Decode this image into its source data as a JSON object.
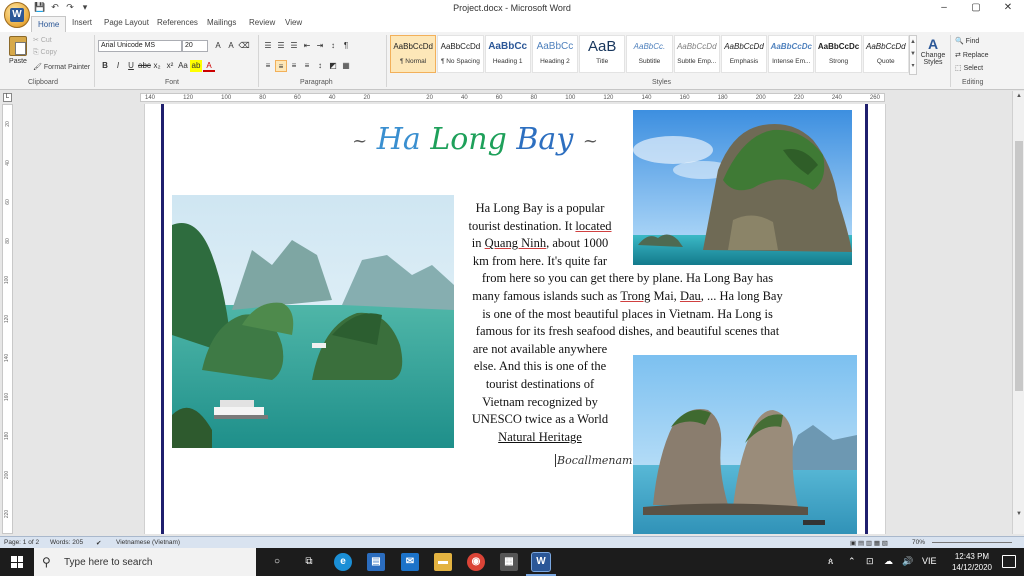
{
  "window": {
    "title": "Project.docx - Microsoft Word",
    "qat": [
      "💾",
      "↶",
      "↷",
      "▾"
    ],
    "controls": [
      "–",
      "▢",
      "✕"
    ]
  },
  "tabs": [
    "Home",
    "Insert",
    "Page Layout",
    "References",
    "Mailings",
    "Review",
    "View"
  ],
  "ribbon": {
    "clipboard": {
      "paste": "Paste",
      "cut": "Cut",
      "copy": "Copy",
      "format_painter": "Format Painter",
      "label": "Clipboard"
    },
    "font": {
      "name": "Arial Unicode MS",
      "size": "20",
      "buttons": [
        "B",
        "I",
        "U",
        "abc",
        "x₂",
        "x²",
        "Aa",
        "ab",
        "A"
      ],
      "size_buttons": [
        "A",
        "A",
        "⌫"
      ],
      "label": "Font"
    },
    "paragraph": {
      "label": "Paragraph",
      "top_buttons": [
        "☰",
        "☰",
        "☰",
        "⇤",
        "⇥",
        "↕",
        "¶"
      ],
      "bottom_buttons": [
        "≡",
        "≡",
        "≡",
        "≡",
        "↕",
        "◩",
        "▦"
      ]
    },
    "styles": {
      "label": "Styles",
      "items": [
        {
          "sample": "AaBbCcDd",
          "name": "¶ Normal"
        },
        {
          "sample": "AaBbCcDd",
          "name": "¶ No Spacing"
        },
        {
          "sample": "AaBbCc",
          "name": "Heading 1"
        },
        {
          "sample": "AaBbCc",
          "name": "Heading 2"
        },
        {
          "sample": "AaB",
          "name": "Title"
        },
        {
          "sample": "AaBbCc.",
          "name": "Subtitle"
        },
        {
          "sample": "AaBbCcDd",
          "name": "Subtle Emp..."
        },
        {
          "sample": "AaBbCcDd",
          "name": "Emphasis"
        },
        {
          "sample": "AaBbCcDc",
          "name": "Intense Em..."
        },
        {
          "sample": "AaBbCcDc",
          "name": "Strong"
        },
        {
          "sample": "AaBbCcDd",
          "name": "Quote"
        }
      ],
      "change_styles": "Change Styles"
    },
    "editing": {
      "label": "Editing",
      "find": "Find",
      "replace": "Replace",
      "select": "Select"
    }
  },
  "ruler": {
    "corner": "L",
    "ticks": [
      "140",
      "120",
      "100",
      "80",
      "60",
      "40",
      "20",
      "",
      "20",
      "40",
      "60",
      "80",
      "100",
      "120",
      "140",
      "160",
      "180",
      "200",
      "220",
      "240",
      "260"
    ],
    "vticks": [
      "20",
      "40",
      "60",
      "80",
      "100",
      "120",
      "140",
      "160",
      "180",
      "200",
      "220"
    ]
  },
  "document": {
    "title_prefix": "~",
    "title_part1": "Ha",
    "title_part2": "Long",
    "title_part3": "Bay",
    "title_suffix": "~",
    "para": {
      "l1": "Ha Long Bay is a popular",
      "l2a": "tourist destination. It ",
      "l2b": "located",
      "l3a": "in ",
      "l3b": "Quang Ninh",
      "l3c": ", about 1000",
      "l4": "km from here. It's quite far",
      "l5": "from here so you can get there by plane. Ha Long Bay has",
      "l6a": "many famous islands such as ",
      "l6b": "Trong",
      "l6c": " Mai, ",
      "l6d": "Dau",
      "l6e": ", ... Ha long Bay",
      "l7": "is one of the most beautiful places in Vietnam. Ha Long is",
      "l8": "famous for its fresh seafood dishes, and beautiful scenes that",
      "l9": "are not available anywhere",
      "l10": "else. And this is one of the",
      "l11": "tourist destinations of",
      "l12": "Vietnam recognized by",
      "l13": "UNESCO twice as a World",
      "l14": "Natural  Heritage"
    },
    "signature": "Bocallmenam"
  },
  "statusbar": {
    "page": "Page: 1 of 2",
    "words": "Words: 205",
    "language": "Vietnamese (Vietnam)",
    "zoom": "70%"
  },
  "taskbar": {
    "search_placeholder": "Type here to search",
    "tray_lang": "VIE",
    "time": "12:43 PM",
    "date": "14/12/2020"
  },
  "colors": {
    "word_blue": "#2b5797",
    "page_border": "#1f1f6e",
    "title_teal": "#3a8fd0",
    "title_green": "#1ea05a"
  }
}
